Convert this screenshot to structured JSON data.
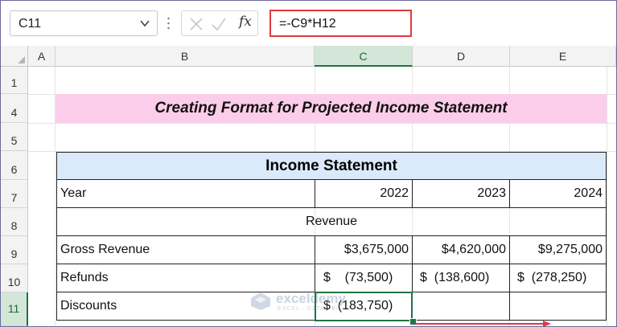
{
  "formula_bar": {
    "name_box": "C11",
    "formula": "=-C9*H12",
    "fx_label": "fx"
  },
  "columns": [
    "A",
    "B",
    "C",
    "D",
    "E"
  ],
  "rows": [
    "1",
    "4",
    "5",
    "6",
    "7",
    "8",
    "9",
    "10",
    "11"
  ],
  "selected_cell": "C11",
  "sheet": {
    "title": "Creating Format for Projected Income Statement",
    "table_header": "Income Statement",
    "year_label": "Year",
    "years": [
      "2022",
      "2023",
      "2024"
    ],
    "section_revenue": "Revenue",
    "gross_revenue": {
      "label": "Gross Revenue",
      "values": [
        "$3,675,000",
        "$4,620,000",
        "$9,275,000"
      ]
    },
    "refunds": {
      "label": "Refunds",
      "values": [
        "$    (73,500)",
        "$  (138,600)",
        "$  (278,250)"
      ]
    },
    "discounts": {
      "label": "Discounts",
      "values": [
        "$  (183,750)",
        "",
        ""
      ]
    }
  },
  "watermark": {
    "name": "exceldemy",
    "tagline": "EXCEL · DATA · BI"
  },
  "colors": {
    "accent_green": "#217346",
    "title_band": "#fccdea",
    "table_header_fill": "#dbeafa",
    "formula_highlight": "#e0383e"
  }
}
